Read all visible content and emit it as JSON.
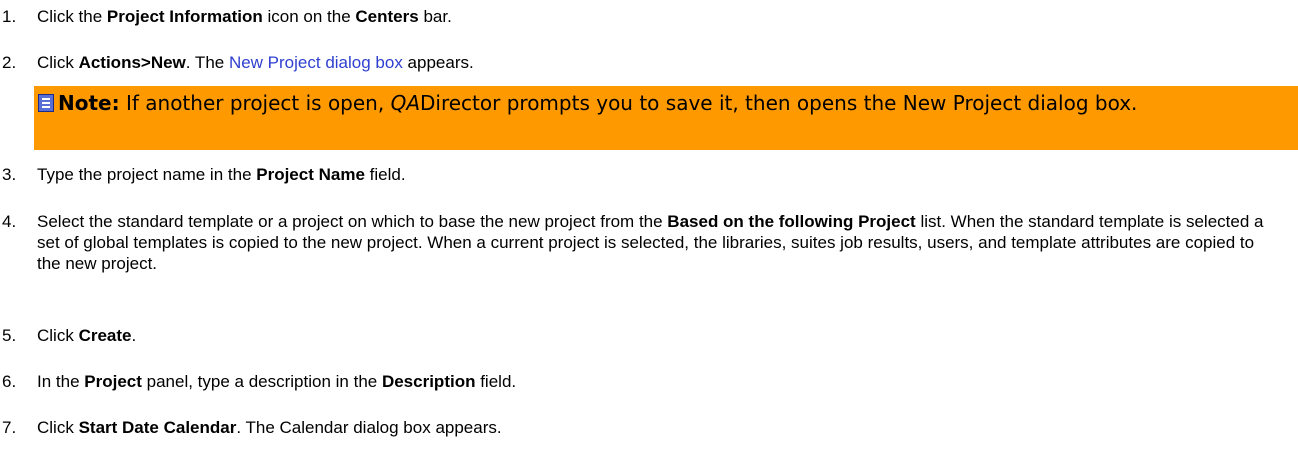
{
  "steps": [
    {
      "num": "1.",
      "parts": [
        "Click the ",
        "Project Information",
        " icon on the ",
        "Centers",
        " bar."
      ]
    },
    {
      "num": "2.",
      "parts": [
        "Click ",
        "Actions>New",
        ". The ",
        "New Project dialog box",
        " appears."
      ]
    },
    {
      "num": "3.",
      "parts": [
        "Type the project name in the ",
        "Project Name",
        " field."
      ]
    },
    {
      "num": "4.",
      "parts": [
        "Select the standard template or a project on which to base the new project from the ",
        "Based on the following Project",
        " list. When the standard template is selected a set of global templates is copied to the new project.  When a current project is selected, the libraries, suites job results, users, and template attributes are copied to the new project."
      ]
    },
    {
      "num": "5.",
      "parts": [
        "Click ",
        "Create",
        "."
      ]
    },
    {
      "num": "6.",
      "parts": [
        "In the ",
        "Project",
        " panel, type a description in the ",
        "Description",
        " field."
      ]
    },
    {
      "num": "7.",
      "parts": [
        "Click ",
        "Start Date Calendar",
        ". The Calendar dialog box appears."
      ]
    }
  ],
  "note": {
    "label": "Note:",
    "prefix": " If another project is open, ",
    "product_italic": "QA",
    "product_rest": "Director",
    "suffix": " prompts you to save it, then opens the New Project dialog box."
  },
  "colors": {
    "note_bg": "#ff9900",
    "link": "#2f3fd0"
  }
}
